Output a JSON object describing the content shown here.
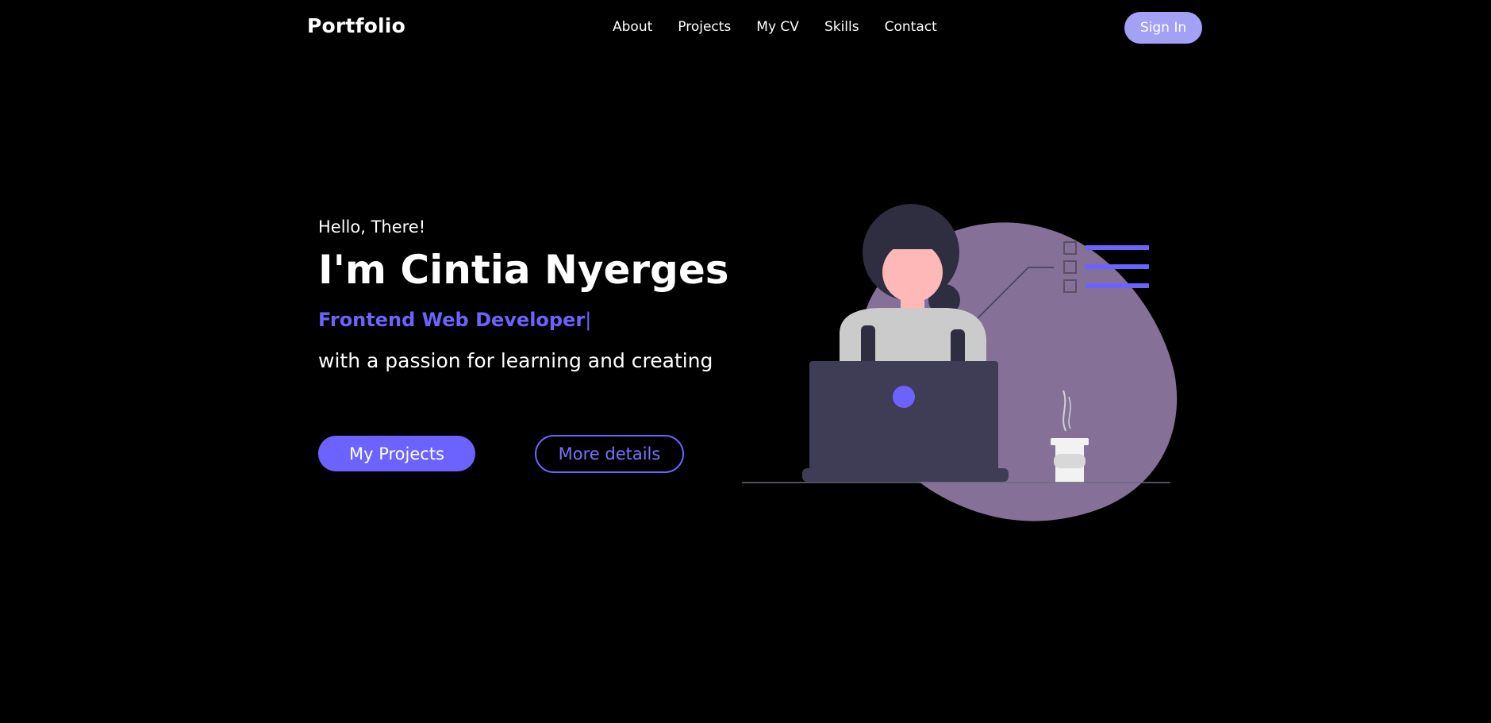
{
  "nav": {
    "brand": "Portfolio",
    "links": [
      "About",
      "Projects",
      "My CV",
      "Skills",
      "Contact"
    ],
    "signin_label": "Sign In"
  },
  "hero": {
    "greeting": "Hello, There!",
    "title": "I'm Cintia Nyerges",
    "role": "Frontend Web Developer",
    "cursor": "|",
    "tagline": "with a passion for learning and creating",
    "primary_button": "My Projects",
    "secondary_button": "More details"
  },
  "illustration": {
    "description_icon": "woman-at-laptop-illustration",
    "colors": {
      "blob": "#857198",
      "laptop": "#3f3d56",
      "accent": "#6c63ff",
      "skin": "#ffb8b8",
      "hair": "#2f2e41",
      "shirt": "#cbcbcb",
      "cup": "#f2f2f2"
    }
  },
  "colors": {
    "background": "#000000",
    "accent": "#6c63ff",
    "signin_bg": "#a3a1f5",
    "text": "#ffffff"
  }
}
